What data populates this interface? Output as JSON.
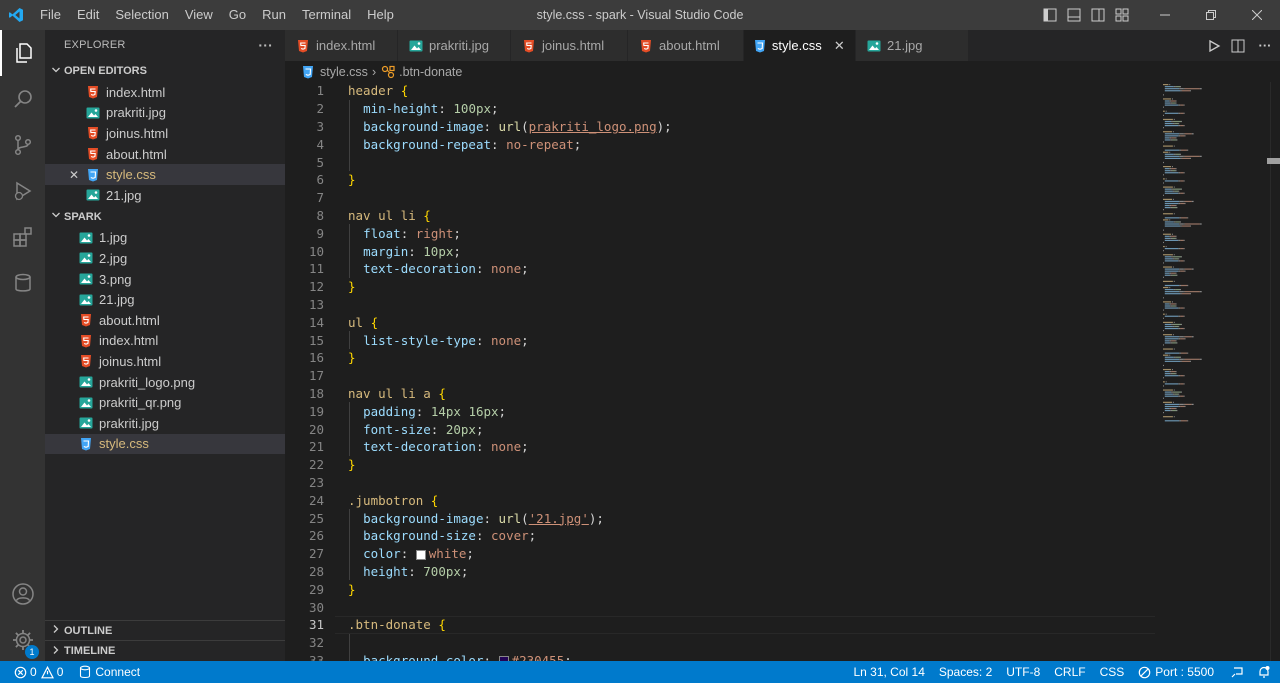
{
  "window": {
    "title": "style.css - spark - Visual Studio Code",
    "menu": [
      "File",
      "Edit",
      "Selection",
      "View",
      "Go",
      "Run",
      "Terminal",
      "Help"
    ]
  },
  "colors": {
    "accent": "#007acc",
    "html_icon": "#e44d26",
    "css_icon": "#42a5f5",
    "image_icon": "#26a69a"
  },
  "sidebar": {
    "header": "EXPLORER",
    "more": "···",
    "open_editors_title": "OPEN EDITORS",
    "open_editors": [
      {
        "label": "index.html",
        "icon": "html-icon"
      },
      {
        "label": "prakriti.jpg",
        "icon": "image-icon"
      },
      {
        "label": "joinus.html",
        "icon": "html-icon"
      },
      {
        "label": "about.html",
        "icon": "html-icon"
      },
      {
        "label": "style.css",
        "icon": "css-icon"
      },
      {
        "label": "21.jpg",
        "icon": "image-icon"
      }
    ],
    "folder_title": "SPARK",
    "files": [
      {
        "label": "1.jpg",
        "icon": "image-icon"
      },
      {
        "label": "2.jpg",
        "icon": "image-icon"
      },
      {
        "label": "3.png",
        "icon": "image-icon"
      },
      {
        "label": "21.jpg",
        "icon": "image-icon"
      },
      {
        "label": "about.html",
        "icon": "html-icon"
      },
      {
        "label": "index.html",
        "icon": "html-icon"
      },
      {
        "label": "joinus.html",
        "icon": "html-icon"
      },
      {
        "label": "prakriti_logo.png",
        "icon": "image-icon"
      },
      {
        "label": "prakriti_qr.png",
        "icon": "image-icon"
      },
      {
        "label": "prakriti.jpg",
        "icon": "image-icon"
      },
      {
        "label": "style.css",
        "icon": "css-icon"
      }
    ],
    "outline_title": "OUTLINE",
    "timeline_title": "TIMELINE"
  },
  "tabs": [
    {
      "label": "index.html",
      "icon": "html-icon"
    },
    {
      "label": "prakriti.jpg",
      "icon": "image-icon"
    },
    {
      "label": "joinus.html",
      "icon": "html-icon"
    },
    {
      "label": "about.html",
      "icon": "html-icon"
    },
    {
      "label": "style.css",
      "icon": "css-icon",
      "active": true
    },
    {
      "label": "21.jpg",
      "icon": "image-icon"
    }
  ],
  "breadcrumb": {
    "file": "style.css",
    "symbol": ".btn-donate"
  },
  "editor": {
    "current_line": 31,
    "lines": [
      {
        "n": "1",
        "tokens": [
          [
            "sel",
            "header"
          ],
          [
            "pun",
            " "
          ],
          [
            "brace",
            "{"
          ]
        ]
      },
      {
        "n": "2",
        "tokens": [
          [
            "pun",
            "  "
          ],
          [
            "prop",
            "min-height"
          ],
          [
            "pun",
            ": "
          ],
          [
            "num",
            "100px"
          ],
          [
            "pun",
            ";"
          ]
        ]
      },
      {
        "n": "3",
        "tokens": [
          [
            "pun",
            "  "
          ],
          [
            "prop",
            "background-image"
          ],
          [
            "pun",
            ": "
          ],
          [
            "fn",
            "url"
          ],
          [
            "pun",
            "("
          ],
          [
            "val ul",
            "prakriti_logo.png"
          ],
          [
            "pun",
            ");"
          ]
        ]
      },
      {
        "n": "4",
        "tokens": [
          [
            "pun",
            "  "
          ],
          [
            "prop",
            "background-repeat"
          ],
          [
            "pun",
            ": "
          ],
          [
            "val",
            "no-repeat"
          ],
          [
            "pun",
            ";"
          ]
        ]
      },
      {
        "n": "5",
        "tokens": []
      },
      {
        "n": "6",
        "tokens": [
          [
            "brace",
            "}"
          ]
        ]
      },
      {
        "n": "7",
        "tokens": []
      },
      {
        "n": "8",
        "tokens": [
          [
            "sel",
            "nav ul li"
          ],
          [
            "pun",
            " "
          ],
          [
            "brace",
            "{"
          ]
        ]
      },
      {
        "n": "9",
        "tokens": [
          [
            "pun",
            "  "
          ],
          [
            "prop",
            "float"
          ],
          [
            "pun",
            ": "
          ],
          [
            "val",
            "right"
          ],
          [
            "pun",
            ";"
          ]
        ]
      },
      {
        "n": "10",
        "tokens": [
          [
            "pun",
            "  "
          ],
          [
            "prop",
            "margin"
          ],
          [
            "pun",
            ": "
          ],
          [
            "num",
            "10px"
          ],
          [
            "pun",
            ";"
          ]
        ]
      },
      {
        "n": "11",
        "tokens": [
          [
            "pun",
            "  "
          ],
          [
            "prop",
            "text-decoration"
          ],
          [
            "pun",
            ": "
          ],
          [
            "val",
            "none"
          ],
          [
            "pun",
            ";"
          ]
        ]
      },
      {
        "n": "12",
        "tokens": [
          [
            "brace",
            "}"
          ]
        ]
      },
      {
        "n": "13",
        "tokens": []
      },
      {
        "n": "14",
        "tokens": [
          [
            "sel",
            "ul"
          ],
          [
            "pun",
            " "
          ],
          [
            "brace",
            "{"
          ]
        ]
      },
      {
        "n": "15",
        "tokens": [
          [
            "pun",
            "  "
          ],
          [
            "prop",
            "list-style-type"
          ],
          [
            "pun",
            ": "
          ],
          [
            "val",
            "none"
          ],
          [
            "pun",
            ";"
          ]
        ]
      },
      {
        "n": "16",
        "tokens": [
          [
            "brace",
            "}"
          ]
        ]
      },
      {
        "n": "17",
        "tokens": []
      },
      {
        "n": "18",
        "tokens": [
          [
            "sel",
            "nav ul li a"
          ],
          [
            "pun",
            " "
          ],
          [
            "brace",
            "{"
          ]
        ]
      },
      {
        "n": "19",
        "tokens": [
          [
            "pun",
            "  "
          ],
          [
            "prop",
            "padding"
          ],
          [
            "pun",
            ": "
          ],
          [
            "num",
            "14px 16px"
          ],
          [
            "pun",
            ";"
          ]
        ]
      },
      {
        "n": "20",
        "tokens": [
          [
            "pun",
            "  "
          ],
          [
            "prop",
            "font-size"
          ],
          [
            "pun",
            ": "
          ],
          [
            "num",
            "20px"
          ],
          [
            "pun",
            ";"
          ]
        ]
      },
      {
        "n": "21",
        "tokens": [
          [
            "pun",
            "  "
          ],
          [
            "prop",
            "text-decoration"
          ],
          [
            "pun",
            ": "
          ],
          [
            "val",
            "none"
          ],
          [
            "pun",
            ";"
          ]
        ]
      },
      {
        "n": "22",
        "tokens": [
          [
            "brace",
            "}"
          ]
        ]
      },
      {
        "n": "23",
        "tokens": []
      },
      {
        "n": "24",
        "tokens": [
          [
            "sel",
            ".jumbotron"
          ],
          [
            "pun",
            " "
          ],
          [
            "brace",
            "{"
          ]
        ]
      },
      {
        "n": "25",
        "tokens": [
          [
            "pun",
            "  "
          ],
          [
            "prop",
            "background-image"
          ],
          [
            "pun",
            ": "
          ],
          [
            "fn",
            "url"
          ],
          [
            "pun",
            "("
          ],
          [
            "val ul",
            "'21.jpg'"
          ],
          [
            "pun",
            ");"
          ]
        ]
      },
      {
        "n": "26",
        "tokens": [
          [
            "pun",
            "  "
          ],
          [
            "prop",
            "background-size"
          ],
          [
            "pun",
            ": "
          ],
          [
            "val",
            "cover"
          ],
          [
            "pun",
            ";"
          ]
        ]
      },
      {
        "n": "27",
        "tokens": [
          [
            "pun",
            "  "
          ],
          [
            "prop",
            "color"
          ],
          [
            "pun",
            ": "
          ],
          [
            "swatch:#ffffff",
            ""
          ],
          [
            "val",
            "white"
          ],
          [
            "pun",
            ";"
          ]
        ]
      },
      {
        "n": "28",
        "tokens": [
          [
            "pun",
            "  "
          ],
          [
            "prop",
            "height"
          ],
          [
            "pun",
            ": "
          ],
          [
            "num",
            "700px"
          ],
          [
            "pun",
            ";"
          ]
        ]
      },
      {
        "n": "29",
        "tokens": [
          [
            "brace",
            "}"
          ]
        ]
      },
      {
        "n": "30",
        "tokens": []
      },
      {
        "n": "31",
        "tokens": [
          [
            "sel",
            ".btn-donate"
          ],
          [
            "pun",
            " "
          ],
          [
            "brace",
            "{"
          ]
        ]
      },
      {
        "n": "32",
        "tokens": []
      },
      {
        "n": "33",
        "tokens": [
          [
            "pun",
            "  "
          ],
          [
            "prop",
            "background-color"
          ],
          [
            "pun",
            ": "
          ],
          [
            "swatch:#230455",
            ""
          ],
          [
            "val",
            "#230455"
          ],
          [
            "pun",
            ";"
          ]
        ]
      }
    ]
  },
  "statusbar": {
    "errors": "0",
    "warnings": "0",
    "connect": "Connect",
    "position": "Ln 31, Col 14",
    "spaces": "Spaces: 2",
    "encoding": "UTF-8",
    "eol": "CRLF",
    "language": "CSS",
    "port": "Port : 5500"
  }
}
